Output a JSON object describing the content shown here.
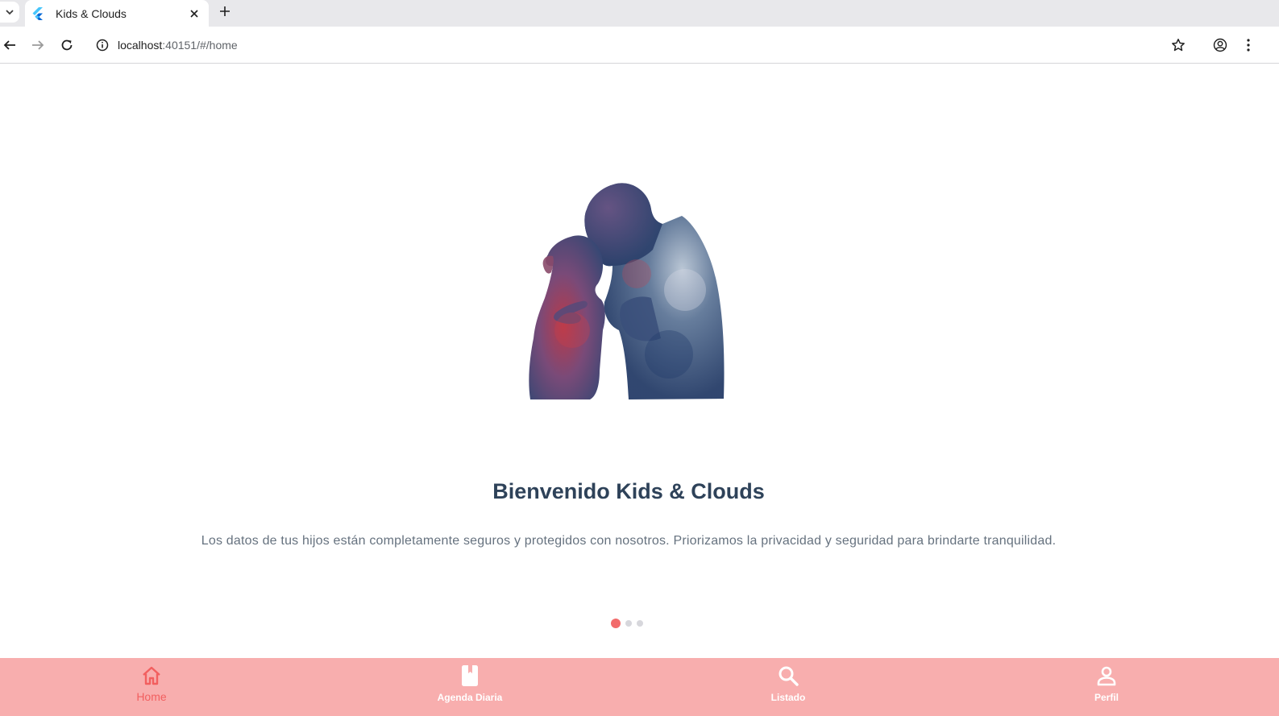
{
  "browser": {
    "tab_title": "Kids & Clouds",
    "url_host": "localhost",
    "url_rest": ":40151/#/home",
    "icons": [
      "tab-search-chevron-icon",
      "flutter-favicon-icon",
      "close-icon",
      "plus-icon",
      "back-arrow-icon",
      "forward-arrow-icon",
      "reload-icon",
      "info-icon",
      "star-icon",
      "account-icon",
      "kebab-menu-icon"
    ]
  },
  "onboarding": {
    "title": "Bienvenido Kids & Clouds",
    "description": "Los datos de tus hijos están completamente seguros y protegidos con nosotros. Priorizamos la privacidad y seguridad para brindarte tranquilidad.",
    "illustration": "watercolor-parent-child-silhouette",
    "page_count": 3,
    "current_page": 1
  },
  "bottom_nav": {
    "items": [
      {
        "label": "Home",
        "icon": "home-icon",
        "active": true
      },
      {
        "label": "Agenda Diaria",
        "icon": "book-icon",
        "active": false
      },
      {
        "label": "Listado",
        "icon": "search-icon",
        "active": false
      },
      {
        "label": "Perfil",
        "icon": "person-icon",
        "active": false
      }
    ]
  },
  "colors": {
    "accent": "#f26b6b",
    "nav_background": "#f8aeae",
    "title_text": "#2e4259",
    "body_text": "#66727f"
  }
}
